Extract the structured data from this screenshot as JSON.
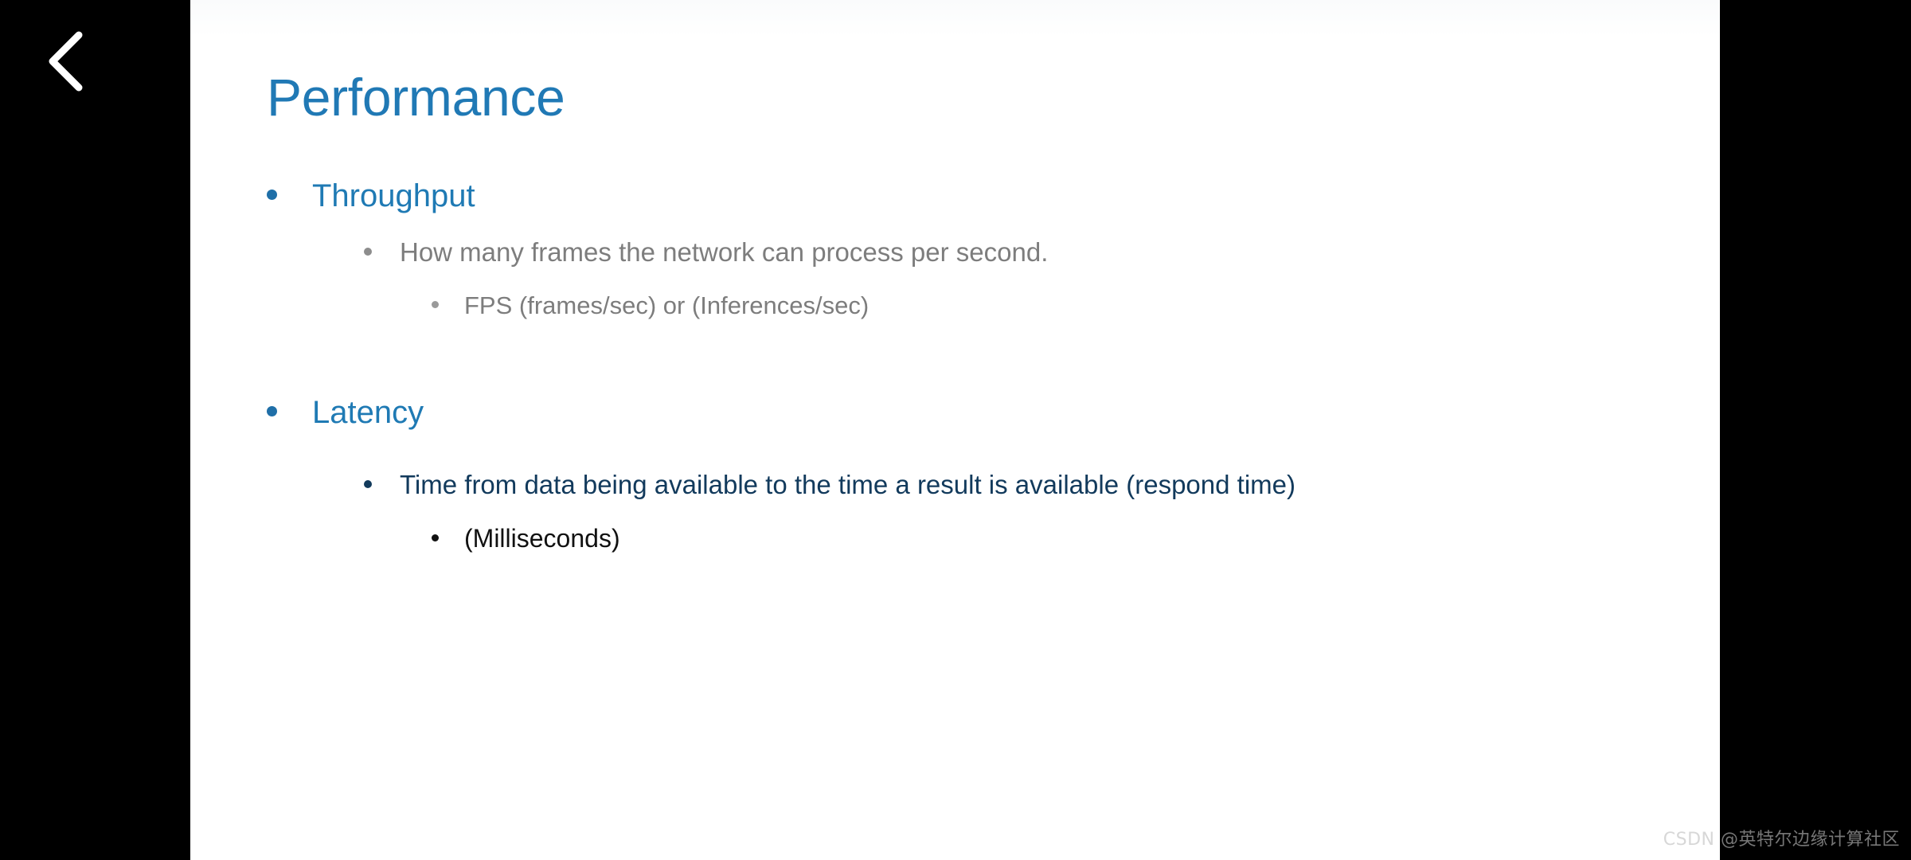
{
  "viewer": {
    "background_color": "#000000",
    "back_button_label": "Back",
    "back_icon": "chevron-left-icon"
  },
  "slide": {
    "background_color": "#ffffff",
    "title": "Performance",
    "title_color": "#2079b5",
    "bullets": [
      {
        "level": 1,
        "text": "Throughput",
        "color": "#1f7ab4"
      },
      {
        "level": 2,
        "text": "How many frames the network can process per second.",
        "color": "#7d7d7d"
      },
      {
        "level": 3,
        "text": "FPS (frames/sec) or (Inferences/sec)",
        "color": "#7d7d7d"
      },
      {
        "level": 1,
        "text": "Latency",
        "color": "#1f7ab4"
      },
      {
        "level": 2,
        "text": "Time from data being available to the time a result is available (respond time)",
        "color": "#123a5c"
      },
      {
        "level": 3,
        "text": "(Milliseconds)",
        "color": "#111111"
      }
    ]
  },
  "watermark": {
    "text": "CSDN @英特尔边缘计算社区"
  }
}
